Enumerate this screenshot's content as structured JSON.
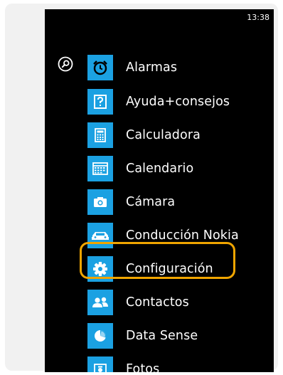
{
  "status": {
    "time": "13:38"
  },
  "search": {
    "icon": "search-icon"
  },
  "apps": [
    {
      "label": "Alarmas",
      "icon": "alarm-clock-icon"
    },
    {
      "label": "Ayuda+consejos",
      "icon": "help-icon"
    },
    {
      "label": "Calculadora",
      "icon": "calculator-icon"
    },
    {
      "label": "Calendario",
      "icon": "calendar-icon"
    },
    {
      "label": "Cámara",
      "icon": "camera-icon"
    },
    {
      "label": "Conducción Nokia",
      "icon": "car-icon"
    },
    {
      "label": "Configuración",
      "icon": "gear-icon"
    },
    {
      "label": "Contactos",
      "icon": "people-icon"
    },
    {
      "label": "Data Sense",
      "icon": "pie-chart-icon"
    },
    {
      "label": "Fotos",
      "icon": "photo-icon"
    }
  ],
  "colors": {
    "tile": "#1ba1e2",
    "highlight": "#f0a500",
    "background": "#000000"
  }
}
